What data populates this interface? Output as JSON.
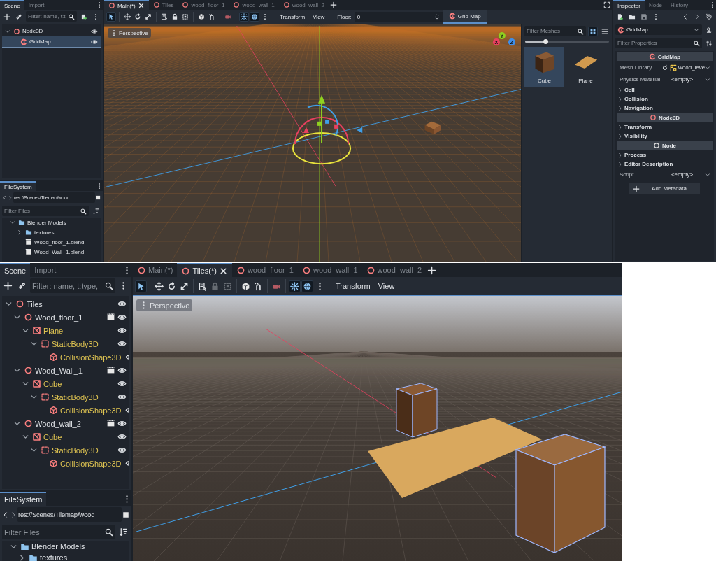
{
  "top_editor": {
    "scene_dock": {
      "tabs": [
        {
          "label": "Scene",
          "selected": true
        },
        {
          "label": "Import",
          "selected": false
        }
      ],
      "filter": {
        "placeholder": "Filter: name, t:t"
      },
      "tree": [
        {
          "name": "Node3D",
          "kind": "node3d",
          "selected": false,
          "expanded": true,
          "inherited": false,
          "instanced": false,
          "children": [
            {
              "name": "GridMap",
              "kind": "gridmap",
              "selected": true,
              "inherited": false,
              "instanced": false
            }
          ]
        }
      ]
    },
    "filesystem": {
      "tabs": [
        {
          "label": "FileSystem",
          "selected": true
        }
      ],
      "path": "res://Scenes/Tilemap/wood",
      "filter": {
        "placeholder": "Filter Files"
      },
      "tree": [
        {
          "name": "Blender Models",
          "kind": "folder",
          "expanded": true,
          "children": [
            {
              "name": "textures",
              "kind": "folder",
              "expanded": false
            },
            {
              "name": "Wood_floor_1.blend",
              "kind": "file"
            },
            {
              "name": "Wood_Wall_1.blend",
              "kind": "file"
            }
          ]
        }
      ]
    },
    "scene_tabs": [
      {
        "label": "Main(*)",
        "selected": true
      },
      {
        "label": "Tiles",
        "selected": false
      },
      {
        "label": "wood_floor_1",
        "selected": false
      },
      {
        "label": "wood_wall_1",
        "selected": false
      },
      {
        "label": "wood_wall_2",
        "selected": false
      }
    ],
    "toolbar": {
      "tools": [
        {
          "kind": "select",
          "active": true,
          "disabled": false
        },
        {
          "kind": "separator"
        },
        {
          "kind": "move",
          "active": false,
          "disabled": false
        },
        {
          "kind": "rotate",
          "active": false,
          "disabled": false
        },
        {
          "kind": "scale",
          "active": false,
          "disabled": false
        },
        {
          "kind": "separator"
        },
        {
          "kind": "list-select",
          "active": false,
          "disabled": false
        },
        {
          "kind": "lock",
          "active": false,
          "disabled": false
        },
        {
          "kind": "group",
          "active": false,
          "disabled": false
        },
        {
          "kind": "separator"
        },
        {
          "kind": "cube",
          "active": false,
          "disabled": false
        },
        {
          "kind": "snap",
          "active": false,
          "disabled": false
        },
        {
          "kind": "separator"
        },
        {
          "kind": "camera",
          "active": false,
          "disabled": false
        },
        {
          "kind": "separator"
        },
        {
          "kind": "sun",
          "active": true,
          "disabled": false
        },
        {
          "kind": "globe",
          "active": true,
          "disabled": false
        },
        {
          "kind": "dots",
          "active": false,
          "disabled": false
        },
        {
          "kind": "separator"
        }
      ],
      "menus": [
        "Transform",
        "View"
      ],
      "floor": {
        "label": "Floor:",
        "value": "0"
      },
      "plugin_button": {
        "label": "Grid Map",
        "selected": true
      }
    },
    "viewport": {
      "view_menu": "Perspective",
      "axes": [
        {
          "label": "Y",
          "color": "#8fd120"
        },
        {
          "label": "X",
          "color": "#e8405f"
        },
        {
          "label": "Z",
          "color": "#3f8ee8"
        }
      ]
    },
    "mesh_palette": {
      "filter": {
        "placeholder": "Filter Meshes"
      },
      "views": [
        {
          "kind": "grid",
          "selected": true
        },
        {
          "kind": "list",
          "selected": false
        }
      ],
      "zoom": {
        "level": 0.25
      },
      "items": [
        {
          "name": "Cube",
          "kind": "cube",
          "selected": true
        },
        {
          "name": "Plane",
          "kind": "plane",
          "selected": false
        }
      ]
    },
    "inspector": {
      "tabs": [
        {
          "label": "Inspector",
          "selected": true
        },
        {
          "label": "Node",
          "selected": false
        },
        {
          "label": "History",
          "selected": false
        }
      ],
      "object": "GridMap",
      "filter": {
        "placeholder": "Filter Properties"
      },
      "rows": [
        {
          "kind": "header",
          "label": "GridMap"
        },
        {
          "kind": "property",
          "label": "Mesh Library",
          "value": "wood_leve",
          "resource": true
        },
        {
          "kind": "property",
          "label": "Physics Material",
          "value": "<empty>",
          "resource": false
        },
        {
          "kind": "group",
          "label": "Cell"
        },
        {
          "kind": "group",
          "label": "Collision"
        },
        {
          "kind": "group",
          "label": "Navigation"
        },
        {
          "kind": "header",
          "label": "Node3D"
        },
        {
          "kind": "group",
          "label": "Transform"
        },
        {
          "kind": "group",
          "label": "Visibility"
        },
        {
          "kind": "header",
          "label": "Node"
        },
        {
          "kind": "group",
          "label": "Process"
        },
        {
          "kind": "group",
          "label": "Editor Description"
        },
        {
          "kind": "property",
          "label": "Script",
          "value": "<empty>",
          "resource": false
        }
      ],
      "add_button": "Add Metadata"
    }
  },
  "bottom_editor": {
    "scene_dock": {
      "tabs": [
        {
          "label": "Scene",
          "selected": true
        },
        {
          "label": "Import",
          "selected": false
        }
      ],
      "filter": {
        "placeholder": "Filter: name, t:type,"
      },
      "tree": [
        {
          "name": "Tiles",
          "kind": "node3d",
          "selected": false,
          "expanded": true,
          "inherited": false,
          "instanced": false,
          "children": [
            {
              "name": "Wood_floor_1",
              "kind": "node3d",
              "selected": false,
              "expanded": true,
              "inherited": false,
              "instanced": true,
              "children": [
                {
                  "name": "Plane",
                  "kind": "mesh",
                  "selected": false,
                  "expanded": true,
                  "inherited": true,
                  "instanced": false,
                  "children": [
                    {
                      "name": "StaticBody3D",
                      "kind": "body",
                      "selected": false,
                      "expanded": true,
                      "inherited": true,
                      "instanced": false,
                      "children": [
                        {
                          "name": "CollisionShape3D",
                          "kind": "shape",
                          "selected": false,
                          "inherited": true,
                          "instanced": false
                        }
                      ]
                    }
                  ]
                }
              ]
            },
            {
              "name": "Wood_Wall_1",
              "kind": "node3d",
              "selected": false,
              "expanded": true,
              "inherited": false,
              "instanced": true,
              "children": [
                {
                  "name": "Cube",
                  "kind": "mesh",
                  "selected": false,
                  "expanded": true,
                  "inherited": true,
                  "instanced": false,
                  "children": [
                    {
                      "name": "StaticBody3D",
                      "kind": "body",
                      "selected": false,
                      "expanded": true,
                      "inherited": true,
                      "instanced": false,
                      "children": [
                        {
                          "name": "CollisionShape3D",
                          "kind": "shape",
                          "selected": false,
                          "inherited": true,
                          "instanced": false
                        }
                      ]
                    }
                  ]
                }
              ]
            },
            {
              "name": "Wood_wall_2",
              "kind": "node3d",
              "selected": false,
              "expanded": true,
              "inherited": false,
              "instanced": true,
              "children": [
                {
                  "name": "Cube",
                  "kind": "mesh",
                  "selected": false,
                  "expanded": true,
                  "inherited": true,
                  "instanced": false,
                  "children": [
                    {
                      "name": "StaticBody3D",
                      "kind": "body",
                      "selected": false,
                      "expanded": true,
                      "inherited": true,
                      "instanced": false,
                      "children": [
                        {
                          "name": "CollisionShape3D",
                          "kind": "shape",
                          "selected": false,
                          "inherited": true,
                          "instanced": false
                        }
                      ]
                    }
                  ]
                }
              ]
            }
          ]
        }
      ]
    },
    "filesystem": {
      "tabs": [
        {
          "label": "FileSystem",
          "selected": true
        }
      ],
      "path": "res://Scenes/Tilemap/wood",
      "filter": {
        "placeholder": "Filter Files"
      },
      "tree": [
        {
          "name": "Blender Models",
          "kind": "folder",
          "expanded": true,
          "children": [
            {
              "name": "textures",
              "kind": "folder",
              "expanded": false
            }
          ]
        }
      ]
    },
    "scene_tabs": [
      {
        "label": "Main(*)",
        "selected": false
      },
      {
        "label": "Tiles(*)",
        "selected": true
      },
      {
        "label": "wood_floor_1",
        "selected": false
      },
      {
        "label": "wood_wall_1",
        "selected": false
      },
      {
        "label": "wood_wall_2",
        "selected": false
      }
    ],
    "toolbar": {
      "tools": [
        {
          "kind": "select",
          "active": true,
          "disabled": false
        },
        {
          "kind": "separator"
        },
        {
          "kind": "move",
          "active": false,
          "disabled": false
        },
        {
          "kind": "rotate",
          "active": false,
          "disabled": false
        },
        {
          "kind": "scale",
          "active": false,
          "disabled": false
        },
        {
          "kind": "separator"
        },
        {
          "kind": "list-select",
          "active": false,
          "disabled": false
        },
        {
          "kind": "lock",
          "active": false,
          "disabled": true
        },
        {
          "kind": "group",
          "active": false,
          "disabled": true
        },
        {
          "kind": "separator"
        },
        {
          "kind": "cube",
          "active": false,
          "disabled": false
        },
        {
          "kind": "snap",
          "active": false,
          "disabled": false
        },
        {
          "kind": "separator"
        },
        {
          "kind": "camera",
          "active": false,
          "disabled": false
        },
        {
          "kind": "separator"
        },
        {
          "kind": "sun",
          "active": true,
          "disabled": false
        },
        {
          "kind": "globe",
          "active": true,
          "disabled": false
        },
        {
          "kind": "dots",
          "active": false,
          "disabled": false
        },
        {
          "kind": "separator"
        }
      ],
      "menus": [
        "Transform",
        "View"
      ]
    },
    "viewport": {
      "view_menu": "Perspective"
    }
  }
}
